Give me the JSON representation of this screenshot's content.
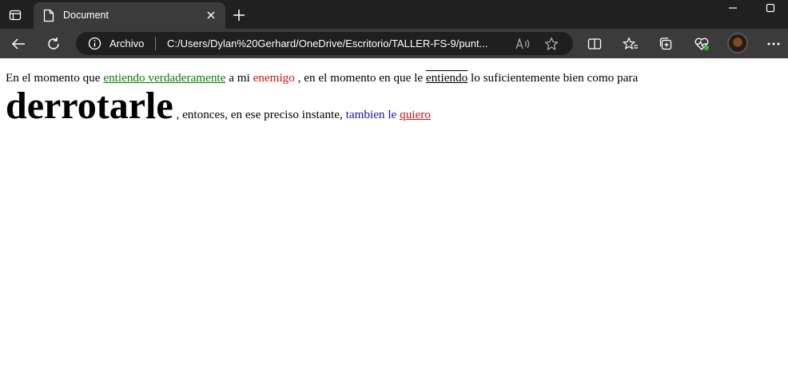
{
  "browser": {
    "tab": {
      "title": "Document"
    },
    "address": {
      "label": "Archivo",
      "url": "C:/Users/Dylan%20Gerhard/OneDrive/Escritorio/TALLER-FS-9/punt..."
    },
    "icons": {
      "tab_actions": "tab-actions-icon",
      "document": "document-icon",
      "close": "close-icon",
      "new_tab": "plus-icon",
      "minimize": "minimize-icon",
      "maximize": "maximize-icon",
      "back": "arrow-left-icon",
      "refresh": "refresh-icon",
      "info": "info-icon",
      "read_aloud": "read-aloud-icon",
      "favorite": "star-icon",
      "split_screen": "split-screen-icon",
      "favorites": "favorites-icon",
      "collections": "collections-icon",
      "performance": "heartbeat-icon",
      "profile": "avatar",
      "menu": "more-icon"
    },
    "colors": {
      "titlebar": "#202020",
      "toolbar": "#3b3b3b",
      "addressbar": "#1f1f1f"
    }
  },
  "content": {
    "line1": {
      "t1": "En el momento que ",
      "t2": "entiendo verdaderamente",
      "t3": " a mi ",
      "t4": "enemigo",
      "t5": " , en el momento en que le ",
      "t6": "entiendo",
      "t7": " lo suficientemente bien como para"
    },
    "line2": {
      "big": "derrotarle",
      "t1": " , entonces, en ese preciso instante, ",
      "t2": "tambien le",
      "t3": " ",
      "t4": "quiero"
    },
    "colors": {
      "green": "#0a7a0a",
      "red": "#cc1111",
      "blue": "#1111bb"
    }
  }
}
